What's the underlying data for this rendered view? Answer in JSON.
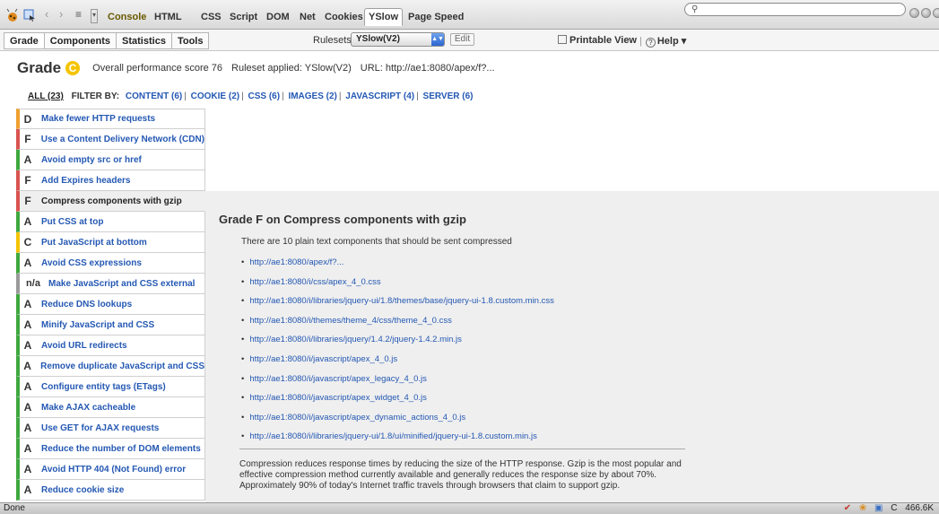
{
  "toolbar": {
    "tabs": [
      "Console",
      "HTML",
      "CSS",
      "Script",
      "DOM",
      "Net",
      "Cookies",
      "YSlow",
      "Page Speed"
    ],
    "active_tab": "YSlow",
    "search_placeholder": ""
  },
  "yslow": {
    "tabs": [
      "Grade",
      "Components",
      "Statistics",
      "Tools"
    ],
    "rulesets_label": "Rulesets",
    "ruleset_value": "YSlow(V2)",
    "edit_label": "Edit",
    "printable_label": "Printable View",
    "help_label": "Help ▾"
  },
  "grade": {
    "title": "Grade",
    "letter": "C",
    "score_text": "Overall performance score 76",
    "ruleset_text": "Ruleset applied: YSlow(V2)",
    "url_text": "URL: http://ae1:8080/apex/f?..."
  },
  "filters": {
    "all": "ALL (23)",
    "filter_by": "FILTER BY:",
    "items": [
      "CONTENT (6)",
      "COOKIE (2)",
      "CSS (6)",
      "IMAGES (2)",
      "JAVASCRIPT (4)",
      "SERVER (6)"
    ]
  },
  "rules": [
    {
      "grade": "D",
      "label": "Make fewer HTTP requests",
      "color": "#f0a030"
    },
    {
      "grade": "F",
      "label": "Use a Content Delivery Network (CDN)",
      "color": "#d9534f"
    },
    {
      "grade": "A",
      "label": "Avoid empty src or href",
      "color": "#3fa93f"
    },
    {
      "grade": "F",
      "label": "Add Expires headers",
      "color": "#d9534f"
    },
    {
      "grade": "F",
      "label": "Compress components with gzip",
      "color": "#d9534f"
    },
    {
      "grade": "A",
      "label": "Put CSS at top",
      "color": "#3fa93f"
    },
    {
      "grade": "C",
      "label": "Put JavaScript at bottom",
      "color": "#f5c400"
    },
    {
      "grade": "A",
      "label": "Avoid CSS expressions",
      "color": "#3fa93f"
    },
    {
      "grade": "n/a",
      "label": "Make JavaScript and CSS external",
      "color": "#9a9a9a"
    },
    {
      "grade": "A",
      "label": "Reduce DNS lookups",
      "color": "#3fa93f"
    },
    {
      "grade": "A",
      "label": "Minify JavaScript and CSS",
      "color": "#3fa93f"
    },
    {
      "grade": "A",
      "label": "Avoid URL redirects",
      "color": "#3fa93f"
    },
    {
      "grade": "A",
      "label": "Remove duplicate JavaScript and CSS",
      "color": "#3fa93f"
    },
    {
      "grade": "A",
      "label": "Configure entity tags (ETags)",
      "color": "#3fa93f"
    },
    {
      "grade": "A",
      "label": "Make AJAX cacheable",
      "color": "#3fa93f"
    },
    {
      "grade": "A",
      "label": "Use GET for AJAX requests",
      "color": "#3fa93f"
    },
    {
      "grade": "A",
      "label": "Reduce the number of DOM elements",
      "color": "#3fa93f"
    },
    {
      "grade": "A",
      "label": "Avoid HTTP 404 (Not Found) error",
      "color": "#3fa93f"
    },
    {
      "grade": "A",
      "label": "Reduce cookie size",
      "color": "#3fa93f"
    }
  ],
  "selected_rule_index": 4,
  "detail": {
    "title": "Grade F on Compress components with gzip",
    "intro": "There are 10 plain text components that should be sent compressed",
    "components": [
      "http://ae1:8080/apex/f?...",
      "http://ae1:8080/i/css/apex_4_0.css",
      "http://ae1:8080/i/libraries/jquery-ui/1.8/themes/base/jquery-ui-1.8.custom.min.css",
      "http://ae1:8080/i/themes/theme_4/css/theme_4_0.css",
      "http://ae1:8080/i/libraries/jquery/1.4.2/jquery-1.4.2.min.js",
      "http://ae1:8080/i/javascript/apex_4_0.js",
      "http://ae1:8080/i/javascript/apex_legacy_4_0.js",
      "http://ae1:8080/i/javascript/apex_widget_4_0.js",
      "http://ae1:8080/i/javascript/apex_dynamic_actions_4_0.js",
      "http://ae1:8080/i/libraries/jquery-ui/1.8/ui/minified/jquery-ui-1.8.custom.min.js"
    ],
    "description": "Compression reduces response times by reducing the size of the HTTP response. Gzip is the most popular and effective compression method currently available and generally reduces the response size by about 70%. Approximately 90% of today's Internet traffic travels through browsers that claim to support gzip."
  },
  "statusbar": {
    "left": "Done",
    "grade": "C",
    "size": "466.6K"
  }
}
